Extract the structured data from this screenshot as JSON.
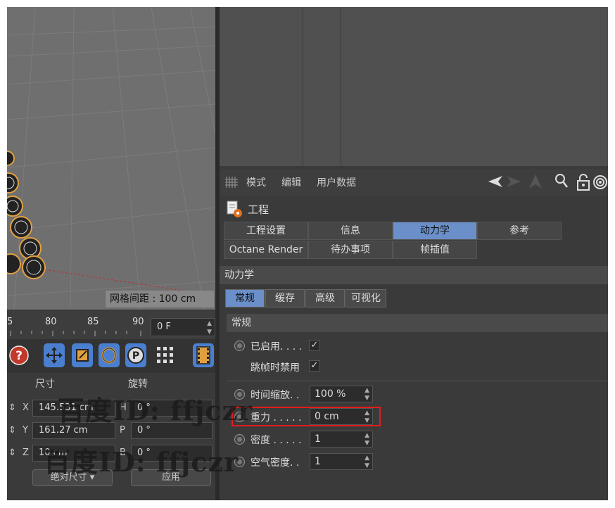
{
  "viewport": {
    "grid_spacing": "网格间距 : 100 cm"
  },
  "timeline": {
    "ticks": [
      "5",
      "80",
      "85",
      "90"
    ],
    "frame": "0 F"
  },
  "toolbar": {
    "items": [
      "help-icon",
      "move-icon",
      "scale-icon",
      "rotate-icon",
      "p-icon",
      "dots-icon",
      "film-icon"
    ]
  },
  "coords": {
    "header_size": "尺寸",
    "header_rot": "旋转",
    "x_label": "X",
    "x_value": "145.531 cm",
    "h_label": "H",
    "h_value": "0 °",
    "y_label": "Y",
    "y_value": "161.27 cm",
    "p_label": "P",
    "p_value": "0 °",
    "z_label": "Z",
    "z_value": "10 cm",
    "b_label": "B",
    "b_value": "0 °",
    "mode": "绝对尺寸",
    "apply": "应用"
  },
  "attr_menu": {
    "mode": "模式",
    "edit": "编辑",
    "user_data": "用户数据"
  },
  "object": {
    "title": "工程"
  },
  "tabs": [
    "工程设置",
    "信息",
    "动力学",
    "参考",
    "Octane Render",
    "待办事项",
    "帧插值"
  ],
  "section_title": "动力学",
  "subtabs": [
    "常规",
    "缓存",
    "高级",
    "可视化"
  ],
  "group_title": "常规",
  "params": {
    "enabled_label": "已启用. . . .",
    "enabled_check": "✓",
    "disable_on_skip_label": "跳帧时禁用",
    "disable_on_skip_check": "✓",
    "time_scale_label": "时间缩放. .",
    "time_scale_value": "100 %",
    "gravity_label": "重力 . . . . .",
    "gravity_value": "0 cm",
    "density_label": "密度 . . . . .",
    "density_value": "1",
    "air_density_label": "空气密度. .",
    "air_density_value": "1"
  },
  "watermark": "百度ID: ffjczr",
  "colors": {
    "accent": "#6a8fc9",
    "highlight": "#e31b1b",
    "panel": "#3a3a3a"
  }
}
